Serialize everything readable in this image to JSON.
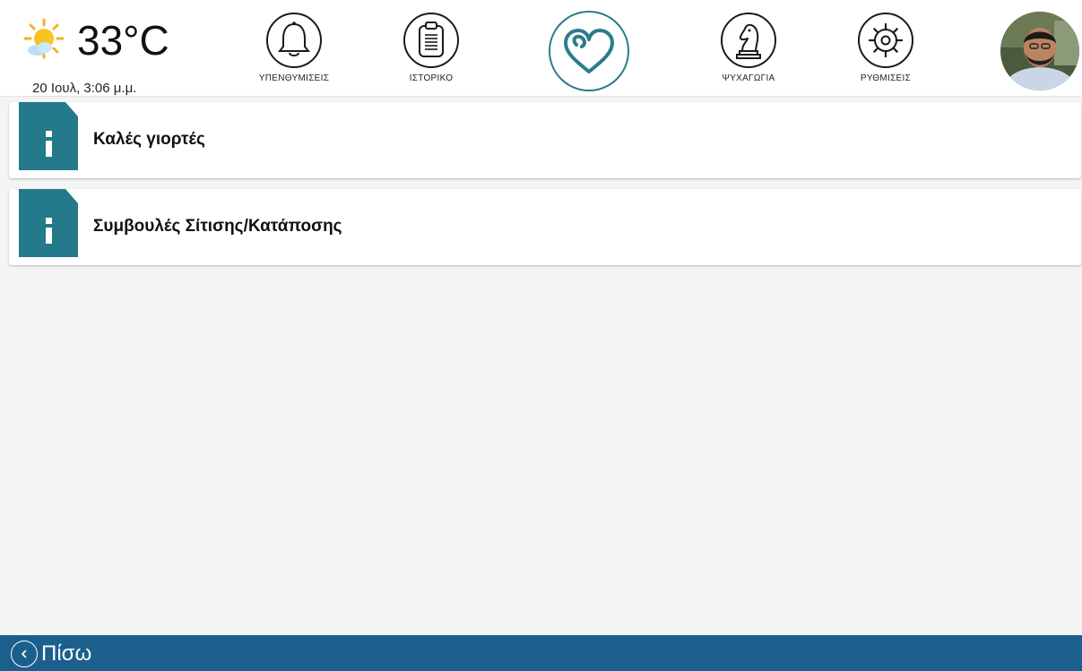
{
  "header": {
    "weather": {
      "icon": "sun-cloud-icon",
      "temperature": "33°C",
      "datetime": "20 Ιουλ, 3:06 μ.μ."
    },
    "nav": [
      {
        "key": "reminders",
        "icon": "bell-icon",
        "label": "ΥΠΕΝΘΥΜΙΣΕΙΣ"
      },
      {
        "key": "history",
        "icon": "clipboard-icon",
        "label": "ΙΣΤΟΡΙΚΟ"
      },
      {
        "key": "health",
        "icon": "heart-icon",
        "label": ""
      },
      {
        "key": "entertainment",
        "icon": "chess-knight-icon",
        "label": "ΨΥΧΑΓΩΓΙΑ"
      },
      {
        "key": "settings",
        "icon": "gear-icon",
        "label": "ΡΥΘΜΙΣΕΙΣ"
      }
    ],
    "avatar": "user-avatar"
  },
  "items": [
    {
      "icon": "info-icon",
      "title": "Καλές γιορτές"
    },
    {
      "icon": "info-icon",
      "title": "Συμβουλές Σίτισης/Κατάποσης"
    }
  ],
  "footer": {
    "back_icon": "chevron-left-icon",
    "back_label": "Πίσω"
  },
  "colors": {
    "accent": "#2b7c8a",
    "footer": "#1b5f8c",
    "badge": "#247a8a"
  }
}
